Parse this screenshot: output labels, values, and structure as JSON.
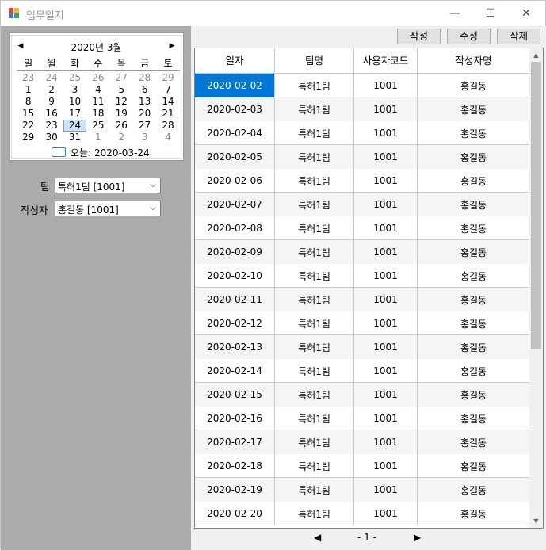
{
  "window": {
    "title": "업무일지",
    "minimize": "—",
    "maximize": "☐",
    "close": "✕"
  },
  "calendar": {
    "title": "2020년 3월",
    "prev": "◀",
    "next": "▶",
    "days_of_week": [
      "일",
      "월",
      "화",
      "수",
      "목",
      "금",
      "토"
    ],
    "weeks": [
      [
        [
          "23",
          true
        ],
        [
          "24",
          true
        ],
        [
          "25",
          true
        ],
        [
          "26",
          true
        ],
        [
          "27",
          true
        ],
        [
          "28",
          true
        ],
        [
          "29",
          true
        ]
      ],
      [
        [
          "1",
          false
        ],
        [
          "2",
          false
        ],
        [
          "3",
          false
        ],
        [
          "4",
          false
        ],
        [
          "5",
          false
        ],
        [
          "6",
          false
        ],
        [
          "7",
          false
        ]
      ],
      [
        [
          "8",
          false
        ],
        [
          "9",
          false
        ],
        [
          "10",
          false
        ],
        [
          "11",
          false
        ],
        [
          "12",
          false
        ],
        [
          "13",
          false
        ],
        [
          "14",
          false
        ]
      ],
      [
        [
          "15",
          false
        ],
        [
          "16",
          false
        ],
        [
          "17",
          false
        ],
        [
          "18",
          false
        ],
        [
          "19",
          false
        ],
        [
          "20",
          false
        ],
        [
          "21",
          false
        ]
      ],
      [
        [
          "22",
          false
        ],
        [
          "23",
          false
        ],
        [
          "24",
          false
        ],
        [
          "25",
          false
        ],
        [
          "26",
          false
        ],
        [
          "27",
          false
        ],
        [
          "28",
          false
        ]
      ],
      [
        [
          "29",
          false
        ],
        [
          "30",
          false
        ],
        [
          "31",
          false
        ],
        [
          "1",
          true
        ],
        [
          "2",
          true
        ],
        [
          "3",
          true
        ],
        [
          "4",
          true
        ]
      ]
    ],
    "selected_day": "24",
    "today_label": "오늘: 2020-03-24"
  },
  "filters": {
    "team_label": "팀",
    "team_value": "특허1팀 [1001]",
    "author_label": "작성자",
    "author_value": "홍길동 [1001]"
  },
  "toolbar": {
    "write": "작성",
    "edit": "수정",
    "delete": "삭제"
  },
  "table": {
    "headers": [
      "일자",
      "팀명",
      "사용자코드",
      "작성자명"
    ],
    "rows": [
      [
        "2020-02-02",
        "특허1팀",
        "1001",
        "홍길동"
      ],
      [
        "2020-02-03",
        "특허1팀",
        "1001",
        "홍길동"
      ],
      [
        "2020-02-04",
        "특허1팀",
        "1001",
        "홍길동"
      ],
      [
        "2020-02-05",
        "특허1팀",
        "1001",
        "홍길동"
      ],
      [
        "2020-02-06",
        "특허1팀",
        "1001",
        "홍길동"
      ],
      [
        "2020-02-07",
        "특허1팀",
        "1001",
        "홍길동"
      ],
      [
        "2020-02-08",
        "특허1팀",
        "1001",
        "홍길동"
      ],
      [
        "2020-02-09",
        "특허1팀",
        "1001",
        "홍길동"
      ],
      [
        "2020-02-10",
        "특허1팀",
        "1001",
        "홍길동"
      ],
      [
        "2020-02-11",
        "특허1팀",
        "1001",
        "홍길동"
      ],
      [
        "2020-02-12",
        "특허1팀",
        "1001",
        "홍길동"
      ],
      [
        "2020-02-13",
        "특허1팀",
        "1001",
        "홍길동"
      ],
      [
        "2020-02-14",
        "특허1팀",
        "1001",
        "홍길동"
      ],
      [
        "2020-02-15",
        "특허1팀",
        "1001",
        "홍길동"
      ],
      [
        "2020-02-16",
        "특허1팀",
        "1001",
        "홍길동"
      ],
      [
        "2020-02-17",
        "특허1팀",
        "1001",
        "홍길동"
      ],
      [
        "2020-02-18",
        "특허1팀",
        "1001",
        "홍길동"
      ],
      [
        "2020-02-19",
        "특허1팀",
        "1001",
        "홍길동"
      ],
      [
        "2020-02-20",
        "특허1팀",
        "1001",
        "홍길동"
      ]
    ],
    "selected_row": 0
  },
  "pager": {
    "prev": "◀",
    "page": "- 1 -",
    "next": "▶"
  },
  "scroll": {
    "up": "▲",
    "down": "▼"
  },
  "colors": {
    "selection": "#0078d7",
    "panel": "#ababab",
    "grid_alt": "#f5f5f5"
  }
}
